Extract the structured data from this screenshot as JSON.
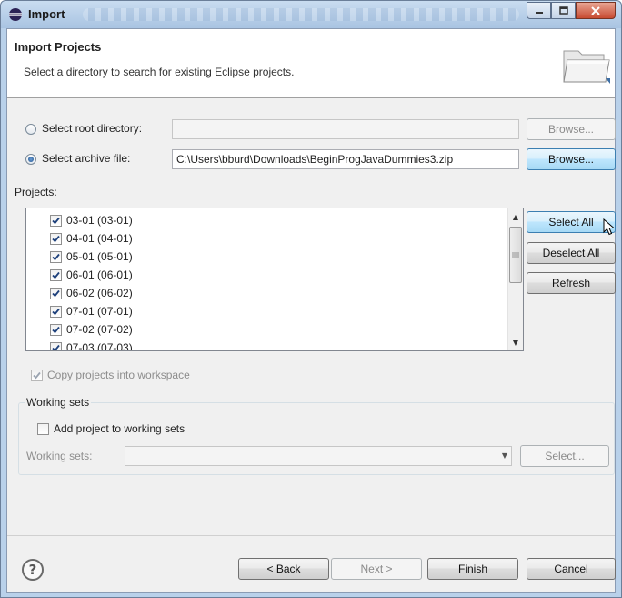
{
  "window": {
    "title": "Import",
    "buttons": {
      "minimize": "minimize-icon",
      "maximize": "maximize-icon",
      "close": "close-icon"
    }
  },
  "header": {
    "title": "Import Projects",
    "description": "Select a directory to search for existing Eclipse projects.",
    "icon": "folder-icon"
  },
  "source": {
    "root_label": "Select root directory:",
    "root_value": "",
    "root_selected": false,
    "root_browse": "Browse...",
    "archive_label": "Select archive file:",
    "archive_value": "C:\\Users\\bburd\\Downloads\\BeginProgJavaDummies3.zip",
    "archive_selected": true,
    "archive_browse": "Browse..."
  },
  "projects": {
    "label": "Projects:",
    "items": [
      {
        "label": "03-01 (03-01)",
        "checked": true
      },
      {
        "label": "04-01 (04-01)",
        "checked": true
      },
      {
        "label": "05-01 (05-01)",
        "checked": true
      },
      {
        "label": "06-01 (06-01)",
        "checked": true
      },
      {
        "label": "06-02 (06-02)",
        "checked": true
      },
      {
        "label": "07-01 (07-01)",
        "checked": true
      },
      {
        "label": "07-02 (07-02)",
        "checked": true
      },
      {
        "label": "07-03 (07-03)",
        "checked": true
      }
    ],
    "select_all": "Select All",
    "deselect_all": "Deselect All",
    "refresh": "Refresh"
  },
  "options": {
    "copy_label": "Copy projects into workspace",
    "copy_checked": true
  },
  "working_sets": {
    "group_title": "Working sets",
    "add_label": "Add project to working sets",
    "add_checked": false,
    "sets_label": "Working sets:",
    "sets_value": "",
    "select_button": "Select..."
  },
  "footer": {
    "help_icon": "help-icon",
    "back": "< Back",
    "next": "Next >",
    "finish": "Finish",
    "cancel": "Cancel"
  }
}
